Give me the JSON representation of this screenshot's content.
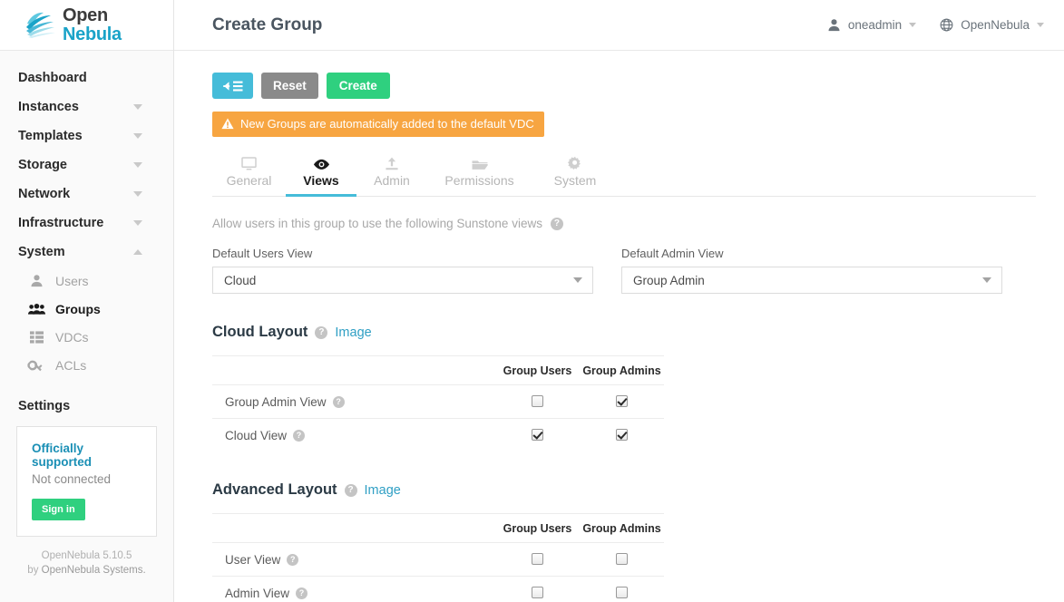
{
  "brand": {
    "name_part1": "Open",
    "name_part2": "Nebula",
    "logo_icon": "opennebula-logo-icon"
  },
  "sidebar": {
    "nav": [
      {
        "label": "Dashboard",
        "caret": "none"
      },
      {
        "label": "Instances",
        "caret": "down"
      },
      {
        "label": "Templates",
        "caret": "down"
      },
      {
        "label": "Storage",
        "caret": "down"
      },
      {
        "label": "Network",
        "caret": "down"
      },
      {
        "label": "Infrastructure",
        "caret": "down"
      },
      {
        "label": "System",
        "caret": "up"
      }
    ],
    "sub_items": [
      {
        "label": "Users",
        "icon": "user-icon",
        "active": false
      },
      {
        "label": "Groups",
        "icon": "users-group-icon",
        "active": true
      },
      {
        "label": "VDCs",
        "icon": "grid-table-icon",
        "active": false
      },
      {
        "label": "ACLs",
        "icon": "key-icon",
        "active": false
      }
    ],
    "settings_label": "Settings",
    "support": {
      "title": "Officially supported",
      "status": "Not connected",
      "button_label": "Sign in"
    },
    "footer": {
      "version": "OpenNebula 5.10.5",
      "by_prefix": "by ",
      "by_company": "OpenNebula Systems."
    }
  },
  "header": {
    "title": "Create Group",
    "user_menu": {
      "label": "oneadmin",
      "icon": "user-icon"
    },
    "zone_menu": {
      "label": "OpenNebula",
      "icon": "globe-icon"
    }
  },
  "toolbar": {
    "back_label": "",
    "back_icon": "back-to-list-icon",
    "reset_label": "Reset",
    "create_label": "Create"
  },
  "alert": {
    "icon": "warning-triangle-icon",
    "message": "New Groups are automatically added to the default VDC",
    "color": "#f7a541"
  },
  "tabs": [
    {
      "label": "General",
      "icon": "monitor-icon",
      "active": false
    },
    {
      "label": "Views",
      "icon": "eye-icon",
      "active": true
    },
    {
      "label": "Admin",
      "icon": "upload-icon",
      "active": false
    },
    {
      "label": "Permissions",
      "icon": "folder-icon",
      "active": false
    },
    {
      "label": "System",
      "icon": "gear-icon",
      "active": false
    }
  ],
  "views_tab": {
    "description": "Allow users in this group to use the following Sunstone views",
    "help_glyph": "?",
    "default_users_view": {
      "label": "Default Users View",
      "value": "Cloud"
    },
    "default_admin_view": {
      "label": "Default Admin View",
      "value": "Group Admin"
    },
    "cloud_layout": {
      "title": "Cloud Layout",
      "image_link": "Image",
      "columns": {
        "lead": "",
        "users": "Group Users",
        "admins": "Group Admins"
      },
      "rows": [
        {
          "label": "Group Admin View",
          "users_checked": false,
          "admins_checked": true
        },
        {
          "label": "Cloud View",
          "users_checked": true,
          "admins_checked": true
        }
      ]
    },
    "advanced_layout": {
      "title": "Advanced Layout",
      "image_link": "Image",
      "columns": {
        "lead": "",
        "users": "Group Users",
        "admins": "Group Admins"
      },
      "rows": [
        {
          "label": "User View",
          "users_checked": false,
          "admins_checked": false
        },
        {
          "label": "Admin View",
          "users_checked": false,
          "admins_checked": false
        }
      ]
    }
  },
  "accent_colors": {
    "cyan": "#45bcd9",
    "green": "#2fd07f",
    "orange": "#f7a541",
    "link_blue": "#2f9fc4"
  }
}
